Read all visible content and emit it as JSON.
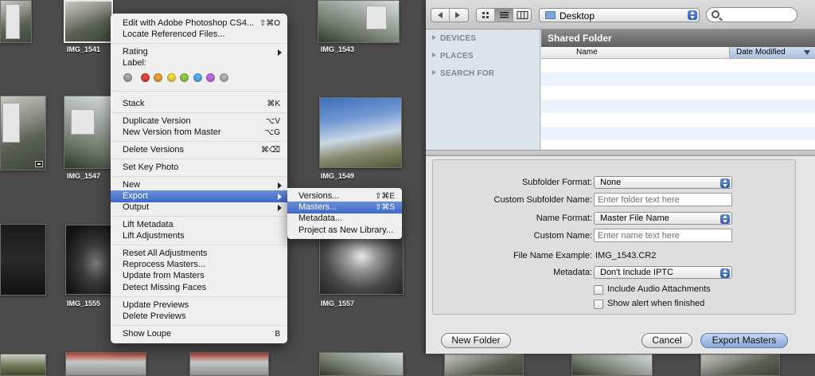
{
  "browser": {
    "captions": [
      "IMG_1541",
      "IMG_1543",
      "IMG_1547",
      "IMG_1549",
      "IMG_1555",
      "IMG_1557"
    ]
  },
  "context_menu": {
    "items": {
      "edit": {
        "label": "Edit with Adobe Photoshop CS4...",
        "shortcut": "⇧⌘O"
      },
      "locate": {
        "label": "Locate Referenced Files..."
      },
      "rating": {
        "label": "Rating"
      },
      "label": {
        "label": "Label:"
      },
      "stack": {
        "label": "Stack",
        "shortcut": "⌘K"
      },
      "duplicate": {
        "label": "Duplicate Version",
        "shortcut": "⌥V"
      },
      "new_from_master": {
        "label": "New Version from Master",
        "shortcut": "⌥G"
      },
      "delete_versions": {
        "label": "Delete Versions",
        "shortcut": "⌘⌫"
      },
      "set_key": {
        "label": "Set Key Photo"
      },
      "new": {
        "label": "New"
      },
      "export": {
        "label": "Export"
      },
      "output": {
        "label": "Output"
      },
      "lift_metadata": {
        "label": "Lift Metadata"
      },
      "lift_adjustments": {
        "label": "Lift Adjustments"
      },
      "reset_adjustments": {
        "label": "Reset All Adjustments"
      },
      "reprocess": {
        "label": "Reprocess Masters..."
      },
      "update_masters": {
        "label": "Update from Masters"
      },
      "detect_faces": {
        "label": "Detect Missing Faces"
      },
      "update_previews": {
        "label": "Update Previews"
      },
      "delete_previews": {
        "label": "Delete Previews"
      },
      "show_loupe": {
        "label": "Show Loupe",
        "shortcut": "B"
      }
    },
    "label_colors": [
      "#a9a9a9",
      "#e8463d",
      "#f2a23a",
      "#f2dc3a",
      "#8fd14f",
      "#5ab0f0",
      "#c36ee0",
      "#b7b7b7"
    ]
  },
  "export_submenu": {
    "versions": {
      "label": "Versions...",
      "shortcut": "⇧⌘E"
    },
    "masters": {
      "label": "Masters...",
      "shortcut": "⇧⌘S"
    },
    "metadata": {
      "label": "Metadata..."
    },
    "project_library": {
      "label": "Project as New Library..."
    }
  },
  "save_panel": {
    "location": "Desktop",
    "sidebar": [
      "DEVICES",
      "PLACES",
      "SEARCH FOR"
    ],
    "folder_title": "Shared Folder",
    "columns": {
      "name": "Name",
      "date_modified": "Date Modified"
    },
    "options": {
      "subfolder_format": {
        "label": "Subfolder Format:",
        "value": "None"
      },
      "custom_subfolder": {
        "label": "Custom Subfolder Name:",
        "placeholder": "Enter folder text here"
      },
      "name_format": {
        "label": "Name Format:",
        "value": "Master File Name"
      },
      "custom_name": {
        "label": "Custom Name:",
        "placeholder": "Enter name text here"
      },
      "file_example": {
        "label": "File Name Example:",
        "value": "IMG_1543.CR2"
      },
      "metadata": {
        "label": "Metadata:",
        "value": "Don't Include IPTC"
      },
      "include_audio": {
        "label": "Include Audio Attachments",
        "checked": false
      },
      "show_alert": {
        "label": "Show alert when finished",
        "checked": false
      }
    },
    "buttons": {
      "new_folder": "New Folder",
      "cancel": "Cancel",
      "export_masters": "Export Masters"
    }
  }
}
